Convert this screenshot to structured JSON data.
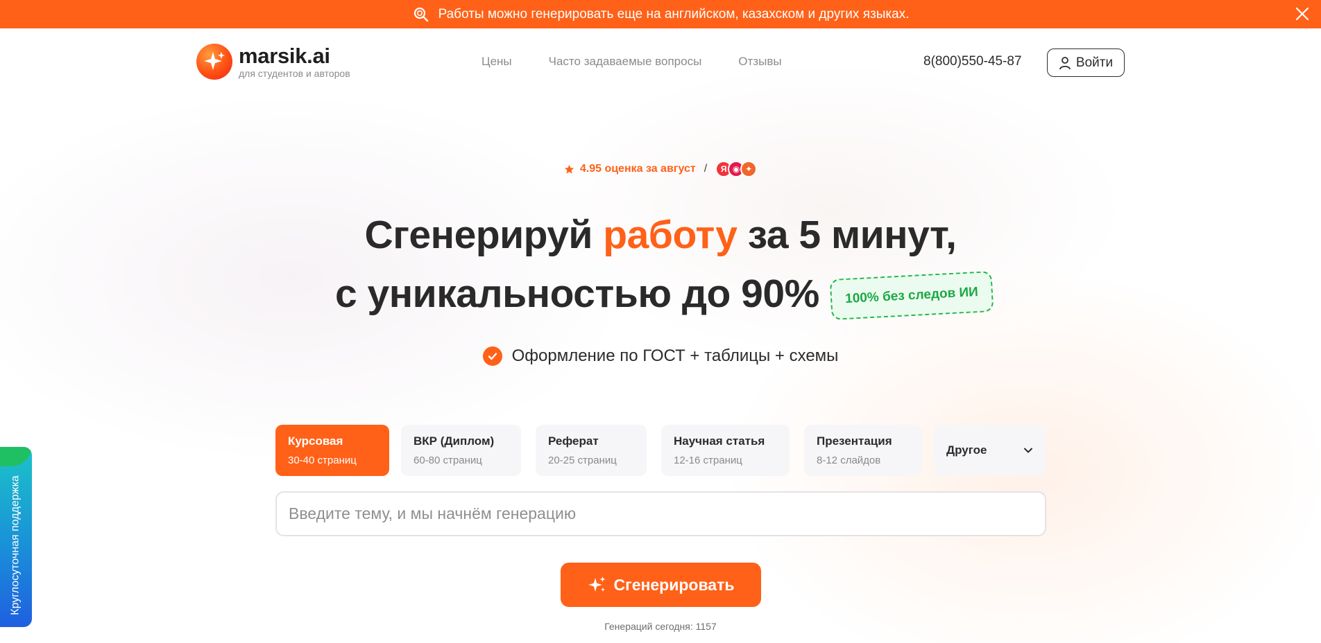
{
  "banner": {
    "text": "Работы можно генерировать еще на английском, казахском и других языках."
  },
  "header": {
    "logo_name": "marsik.ai",
    "logo_subtitle": "для студентов и авторов",
    "nav": [
      {
        "label": "Цены"
      },
      {
        "label": "Часто задаваемые вопросы"
      },
      {
        "label": "Отзывы"
      }
    ],
    "phone": "8(800)550-45-87",
    "login_label": "Войти"
  },
  "rating": {
    "text": "4.95 оценка за август",
    "separator": "/",
    "badges": [
      {
        "glyph": "Я",
        "color": "#f2343a"
      },
      {
        "glyph": "◉",
        "color": "#e21b4a"
      },
      {
        "glyph": "✦",
        "color": "#f0672b"
      }
    ]
  },
  "hero": {
    "line1_before": "Сгенерируй ",
    "line1_accent": "работу",
    "line1_after": " за 5 минут,",
    "line2": "с уникальностью до 90%",
    "badge": "100% без следов ИИ",
    "feature": "Оформление по ГОСТ + таблицы + схемы"
  },
  "work_types": [
    {
      "label": "Курсовая",
      "sub": "30-40 страниц",
      "active": true
    },
    {
      "label": "ВКР (Диплом)",
      "sub": "60-80 страниц",
      "active": false
    },
    {
      "label": "Реферат",
      "sub": "20-25 страниц",
      "active": false
    },
    {
      "label": "Научная статья",
      "sub": "12-16 страниц",
      "active": false
    },
    {
      "label": "Презентация",
      "sub": "8-12 слайдов",
      "active": false
    },
    {
      "label": "Другое",
      "active": false
    }
  ],
  "topic": {
    "value": "",
    "placeholder": "Введите тему, и мы начнём генерацию"
  },
  "generate_label": "Сгенерировать",
  "generations_today": "Генераций сегодня: 1157",
  "support_tab": "Круглосуточная поддержка",
  "colors": {
    "accent": "#ff6118",
    "green": "#1aa845",
    "text": "#2b2b2b"
  }
}
